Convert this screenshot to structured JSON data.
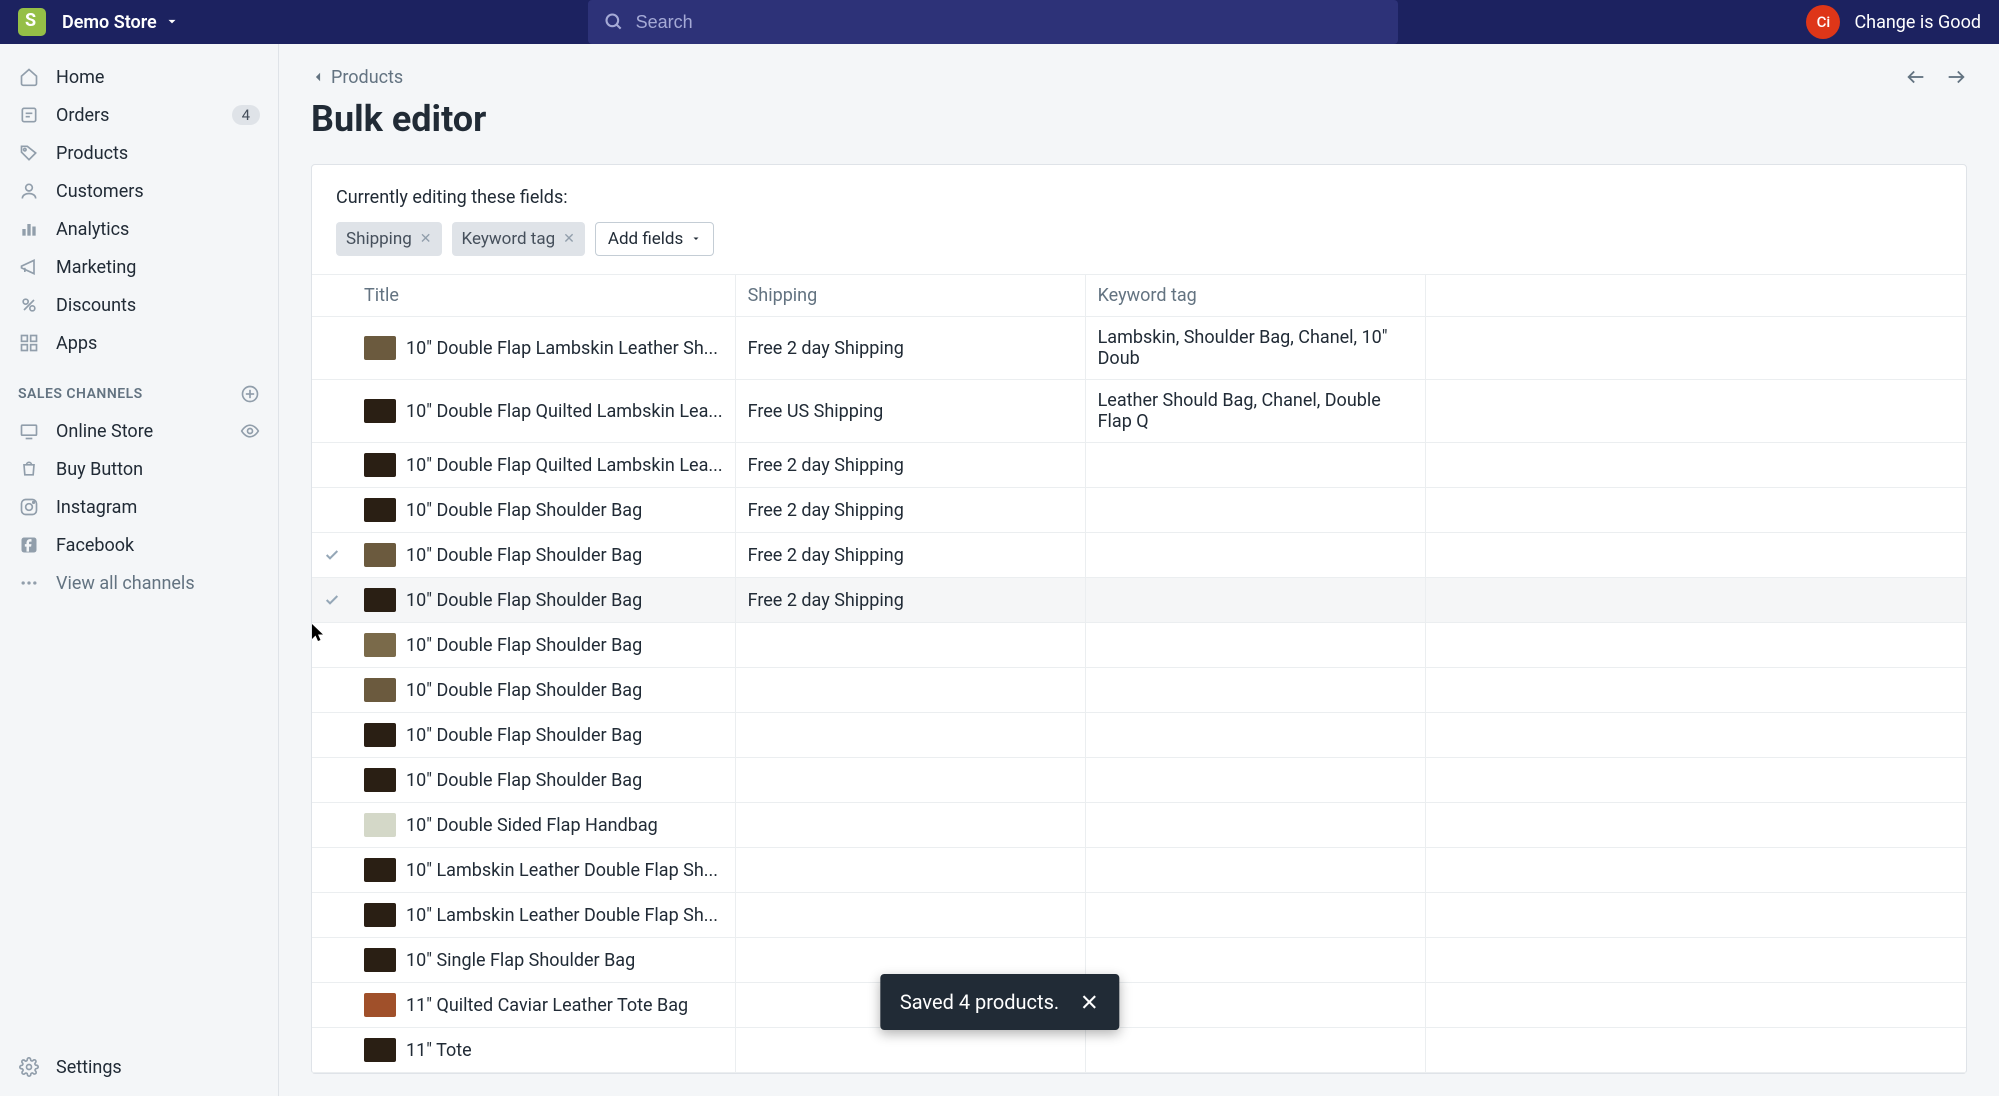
{
  "header": {
    "store_name": "Demo Store",
    "search_placeholder": "Search",
    "user_initials": "Ci",
    "user_name": "Change is Good"
  },
  "sidebar": {
    "nav": [
      {
        "label": "Home"
      },
      {
        "label": "Orders",
        "badge": "4"
      },
      {
        "label": "Products"
      },
      {
        "label": "Customers"
      },
      {
        "label": "Analytics"
      },
      {
        "label": "Marketing"
      },
      {
        "label": "Discounts"
      },
      {
        "label": "Apps"
      }
    ],
    "channels_header": "SALES CHANNELS",
    "channels": [
      {
        "label": "Online Store",
        "eye": true
      },
      {
        "label": "Buy Button"
      },
      {
        "label": "Instagram"
      },
      {
        "label": "Facebook"
      }
    ],
    "view_all": "View all channels",
    "settings": "Settings"
  },
  "breadcrumb": {
    "back_label": "Products"
  },
  "page": {
    "title": "Bulk editor",
    "editing_label": "Currently editing these fields:",
    "chips": [
      {
        "label": "Shipping"
      },
      {
        "label": "Keyword tag"
      }
    ],
    "add_fields": "Add fields"
  },
  "table": {
    "headers": {
      "title": "Title",
      "shipping": "Shipping",
      "keyword": "Keyword tag"
    },
    "rows": [
      {
        "title": "10\" Double Flap Lambskin Leather Sh...",
        "shipping": "Free 2 day Shipping",
        "keyword": "Lambskin, Shoulder Bag, Chanel, 10\" Doub",
        "thumb": "#6b5a3e"
      },
      {
        "title": "10\" Double Flap Quilted Lambskin Lea...",
        "shipping": "Free US Shipping",
        "keyword": "Leather Should Bag, Chanel, Double Flap Q",
        "thumb": "#2a1f14"
      },
      {
        "title": "10\" Double Flap Quilted Lambskin Lea...",
        "shipping": "Free 2 day Shipping",
        "keyword": "",
        "thumb": "#2a1f14"
      },
      {
        "title": "10\" Double Flap Shoulder Bag",
        "shipping": "Free 2 day Shipping",
        "keyword": "",
        "thumb": "#2a1f14"
      },
      {
        "title": "10\" Double Flap Shoulder Bag",
        "shipping": "Free 2 day Shipping",
        "keyword": "",
        "check": true,
        "thumb": "#6b5a3e"
      },
      {
        "title": "10\" Double Flap Shoulder Bag",
        "shipping": "Free 2 day Shipping",
        "keyword": "",
        "check": true,
        "highlight": true,
        "thumb": "#2a1f14"
      },
      {
        "title": "10\" Double Flap Shoulder Bag",
        "shipping": "",
        "keyword": "",
        "thumb": "#7a6a4a"
      },
      {
        "title": "10\" Double Flap Shoulder Bag",
        "shipping": "",
        "keyword": "",
        "thumb": "#6b5a3e"
      },
      {
        "title": "10\" Double Flap Shoulder Bag",
        "shipping": "",
        "keyword": "",
        "thumb": "#2a1f14"
      },
      {
        "title": "10\" Double Flap Shoulder Bag",
        "shipping": "",
        "keyword": "",
        "thumb": "#2a1f14"
      },
      {
        "title": "10\" Double Sided Flap Handbag",
        "shipping": "",
        "keyword": "",
        "thumb": "#d4d8c8"
      },
      {
        "title": "10\" Lambskin Leather Double Flap Sh...",
        "shipping": "",
        "keyword": "",
        "thumb": "#2a1f14"
      },
      {
        "title": "10\" Lambskin Leather Double Flap Sh...",
        "shipping": "",
        "keyword": "",
        "thumb": "#2a1f14"
      },
      {
        "title": "10\" Single Flap Shoulder Bag",
        "shipping": "",
        "keyword": "",
        "thumb": "#2a1f14"
      },
      {
        "title": "11\" Quilted Caviar Leather Tote Bag",
        "shipping": "",
        "keyword": "",
        "thumb": "#a0502a"
      },
      {
        "title": "11\" Tote",
        "shipping": "",
        "keyword": "",
        "thumb": "#2a1f14"
      }
    ]
  },
  "toast": {
    "message": "Saved 4 products."
  }
}
